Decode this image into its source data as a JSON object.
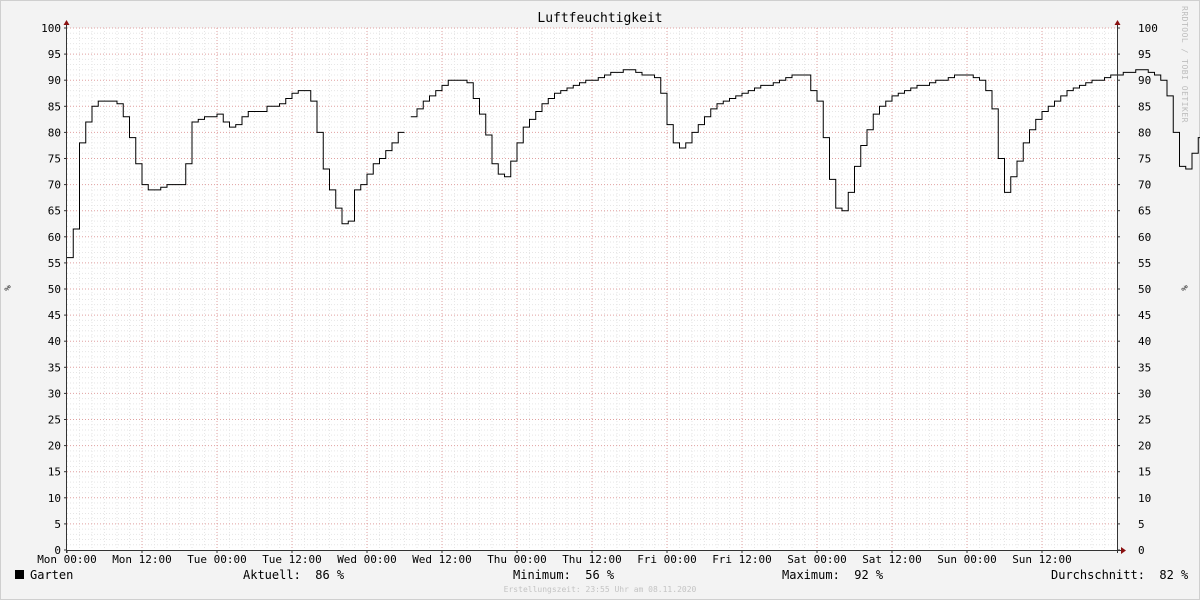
{
  "chart_data": {
    "type": "line",
    "title": "Luftfeuchtigkeit",
    "ylabel": "%",
    "ylim": [
      0,
      100
    ],
    "yticks": [
      0,
      5,
      10,
      15,
      20,
      25,
      30,
      35,
      40,
      45,
      50,
      55,
      60,
      65,
      70,
      75,
      80,
      85,
      90,
      95,
      100
    ],
    "xticks": [
      "Mon 00:00",
      "Mon 12:00",
      "Tue 00:00",
      "Tue 12:00",
      "Wed 00:00",
      "Wed 12:00",
      "Thu 00:00",
      "Thu 12:00",
      "Fri 00:00",
      "Fri 12:00",
      "Sat 00:00",
      "Sat 12:00",
      "Sun 00:00",
      "Sun 12:00"
    ],
    "x_unit": "hours since Mon 00:00",
    "x_range": [
      0,
      168
    ],
    "grid": true,
    "series": [
      {
        "name": "Garten",
        "color": "#000000",
        "points": [
          [
            0,
            56
          ],
          [
            1,
            61.5
          ],
          [
            2,
            78
          ],
          [
            3,
            82
          ],
          [
            4,
            85
          ],
          [
            5,
            86
          ],
          [
            6,
            86
          ],
          [
            7,
            86
          ],
          [
            8,
            85.5
          ],
          [
            9,
            83
          ],
          [
            10,
            79
          ],
          [
            11,
            74
          ],
          [
            12,
            70
          ],
          [
            13,
            69
          ],
          [
            14,
            69
          ],
          [
            15,
            69.5
          ],
          [
            16,
            70
          ],
          [
            17,
            70
          ],
          [
            18,
            70
          ],
          [
            19,
            74
          ],
          [
            20,
            82
          ],
          [
            21,
            82.5
          ],
          [
            22,
            83
          ],
          [
            23,
            83
          ],
          [
            24,
            83.5
          ],
          [
            25,
            82
          ],
          [
            26,
            81
          ],
          [
            27,
            81.5
          ],
          [
            28,
            83
          ],
          [
            29,
            84
          ],
          [
            30,
            84
          ],
          [
            31,
            84
          ],
          [
            32,
            85
          ],
          [
            33,
            85
          ],
          [
            34,
            85.5
          ],
          [
            35,
            86.5
          ],
          [
            36,
            87.5
          ],
          [
            37,
            88
          ],
          [
            38,
            88
          ],
          [
            39,
            86
          ],
          [
            40,
            80
          ],
          [
            41,
            73
          ],
          [
            42,
            69
          ],
          [
            43,
            65.5
          ],
          [
            44,
            62.5
          ],
          [
            45,
            63
          ],
          [
            46,
            69
          ],
          [
            47,
            70
          ],
          [
            48,
            72
          ],
          [
            49,
            74
          ],
          [
            50,
            75
          ],
          [
            51,
            76.5
          ],
          [
            52,
            78
          ],
          [
            53,
            80
          ],
          null,
          [
            55,
            83
          ],
          [
            56,
            84.5
          ],
          [
            57,
            86
          ],
          [
            58,
            87
          ],
          [
            59,
            88
          ],
          [
            60,
            89
          ],
          [
            61,
            90
          ],
          [
            62,
            90
          ],
          [
            63,
            90
          ],
          [
            64,
            89.5
          ],
          [
            65,
            86.5
          ],
          [
            66,
            83.5
          ],
          [
            67,
            79.5
          ],
          [
            68,
            74
          ],
          [
            69,
            72
          ],
          [
            70,
            71.5
          ],
          [
            71,
            74.5
          ],
          [
            72,
            78
          ],
          [
            73,
            81
          ],
          [
            74,
            82.5
          ],
          [
            75,
            84
          ],
          [
            76,
            85.5
          ],
          [
            77,
            86.5
          ],
          [
            78,
            87.5
          ],
          [
            79,
            88
          ],
          [
            80,
            88.5
          ],
          [
            81,
            89
          ],
          [
            82,
            89.5
          ],
          [
            83,
            90
          ],
          [
            84,
            90
          ],
          [
            85,
            90.5
          ],
          [
            86,
            91
          ],
          [
            87,
            91.5
          ],
          [
            88,
            91.5
          ],
          [
            89,
            92
          ],
          [
            90,
            92
          ],
          [
            91,
            91.5
          ],
          [
            92,
            91
          ],
          [
            93,
            91
          ],
          [
            94,
            90.5
          ],
          [
            95,
            87.5
          ],
          [
            96,
            81.5
          ],
          [
            97,
            78
          ],
          [
            98,
            77
          ],
          [
            99,
            78
          ],
          [
            100,
            80
          ],
          [
            101,
            81.5
          ],
          [
            102,
            83
          ],
          [
            103,
            84.5
          ],
          [
            104,
            85.5
          ],
          [
            105,
            86
          ],
          [
            106,
            86.5
          ],
          [
            107,
            87
          ],
          [
            108,
            87.5
          ],
          [
            109,
            88
          ],
          [
            110,
            88.5
          ],
          [
            111,
            89
          ],
          [
            112,
            89
          ],
          [
            113,
            89.5
          ],
          [
            114,
            90
          ],
          [
            115,
            90.5
          ],
          [
            116,
            91
          ],
          [
            117,
            91
          ],
          [
            118,
            91
          ],
          [
            119,
            88
          ],
          [
            120,
            86
          ],
          [
            121,
            79
          ],
          [
            122,
            71
          ],
          [
            123,
            65.5
          ],
          [
            124,
            65
          ],
          [
            125,
            68.5
          ],
          [
            126,
            73.5
          ],
          [
            127,
            77.5
          ],
          [
            128,
            80.5
          ],
          [
            129,
            83.5
          ],
          [
            130,
            85
          ],
          [
            131,
            86
          ],
          [
            132,
            87
          ],
          [
            133,
            87.5
          ],
          [
            134,
            88
          ],
          [
            135,
            88.5
          ],
          [
            136,
            89
          ],
          [
            137,
            89
          ],
          [
            138,
            89.5
          ],
          [
            139,
            90
          ],
          [
            140,
            90
          ],
          [
            141,
            90.5
          ],
          [
            142,
            91
          ],
          [
            143,
            91
          ],
          [
            144,
            91
          ],
          [
            145,
            90.5
          ],
          [
            146,
            90
          ],
          [
            147,
            88
          ],
          [
            148,
            84.5
          ],
          [
            149,
            75
          ],
          [
            150,
            68.5
          ],
          [
            151,
            71.5
          ],
          [
            152,
            74.5
          ],
          [
            153,
            78
          ],
          [
            154,
            80.5
          ],
          [
            155,
            82.5
          ],
          [
            156,
            84
          ],
          [
            157,
            85
          ],
          [
            158,
            86
          ],
          [
            159,
            87
          ],
          [
            160,
            88
          ],
          [
            161,
            88.5
          ],
          [
            162,
            89
          ],
          [
            163,
            89.5
          ],
          [
            164,
            90
          ],
          [
            165,
            90
          ],
          [
            166,
            90.5
          ],
          [
            167,
            91
          ],
          [
            168,
            91
          ],
          [
            169,
            91.5
          ],
          [
            170,
            91.5
          ],
          [
            171,
            92
          ],
          [
            172,
            92
          ],
          [
            173,
            91.5
          ],
          [
            174,
            91
          ],
          [
            175,
            90
          ],
          [
            176,
            87
          ],
          [
            177,
            80
          ],
          [
            178,
            73.5
          ],
          [
            179,
            73
          ],
          [
            180,
            76
          ],
          [
            181,
            79
          ],
          [
            182,
            81.5
          ],
          [
            183,
            83
          ],
          [
            184,
            84.5
          ],
          [
            185,
            85
          ],
          [
            186,
            85.5
          ],
          [
            187,
            86
          ]
        ]
      }
    ]
  },
  "watermark": "RRDTOOL / TOBI OETIKER",
  "legend": {
    "series_name": "Garten",
    "aktuell_label": "Aktuell:",
    "aktuell_value": "86 %",
    "minimum_label": "Minimum:",
    "minimum_value": "56 %",
    "maximum_label": "Maximum:",
    "maximum_value": "92 %",
    "durchschnitt_label": "Durchschnitt:",
    "durchschnitt_value": "82 %"
  },
  "created": "Erstellungszeit: 23:55 Uhr am 08.11.2020"
}
